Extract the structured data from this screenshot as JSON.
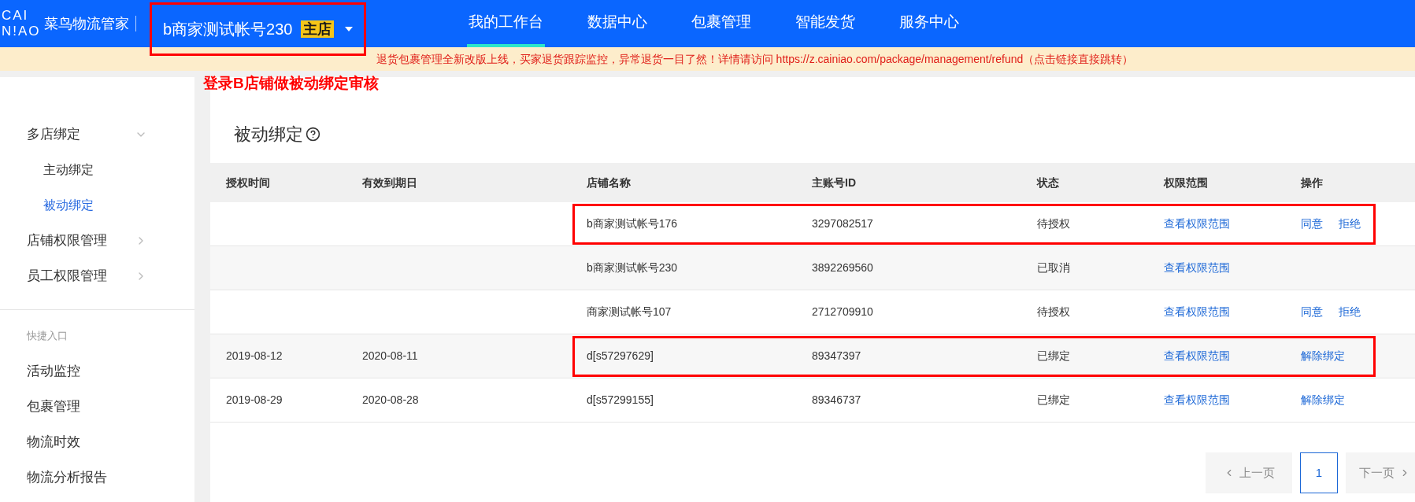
{
  "header": {
    "logo_mark": "CAI\nN!AO",
    "logo_text": "菜鸟物流管家",
    "account": "b商家测试帐号230",
    "account_badge": "主店",
    "nav": [
      {
        "label": "我的工作台",
        "selected": true
      },
      {
        "label": "数据中心",
        "selected": false
      },
      {
        "label": "包裹管理",
        "selected": false
      },
      {
        "label": "智能发货",
        "selected": false
      },
      {
        "label": "服务中心",
        "selected": false
      }
    ]
  },
  "notice": "退货包裹管理全新改版上线，买家退货跟踪监控，异常退货一目了然！详情请访问 https://z.cainiao.com/package/management/refund（点击链接直接跳转）",
  "annotation": "登录B店铺做被动绑定审核",
  "sidebar": {
    "groups": [
      {
        "label": "多店绑定",
        "expanded": true,
        "children": [
          {
            "label": "主动绑定",
            "selected": false
          },
          {
            "label": "被动绑定",
            "selected": true
          }
        ]
      },
      {
        "label": "店铺权限管理",
        "expanded": false
      },
      {
        "label": "员工权限管理",
        "expanded": false
      }
    ],
    "shortcut_title": "快捷入口",
    "shortcuts": [
      "活动监控",
      "包裹管理",
      "物流时效",
      "物流分析报告"
    ]
  },
  "page_title": "被动绑定",
  "table": {
    "columns": [
      "授权时间",
      "有效到期日",
      "店铺名称",
      "主账号ID",
      "状态",
      "权限范围",
      "操作"
    ],
    "rows": [
      {
        "auth_time": "",
        "expiry": "",
        "store": "b商家测试帐号176",
        "account_id": "3297082517",
        "status": "待授权",
        "scope": "查看权限范围",
        "actions": [
          "同意",
          "拒绝"
        ],
        "highlighted": true
      },
      {
        "auth_time": "",
        "expiry": "",
        "store": "b商家测试帐号230",
        "account_id": "3892269560",
        "status": "已取消",
        "scope": "查看权限范围",
        "actions": [],
        "highlighted": false
      },
      {
        "auth_time": "",
        "expiry": "",
        "store": "商家测试帐号107",
        "account_id": "2712709910",
        "status": "待授权",
        "scope": "查看权限范围",
        "actions": [
          "同意",
          "拒绝"
        ],
        "highlighted": false
      },
      {
        "auth_time": "2019-08-12",
        "expiry": "2020-08-11",
        "store": "d[s57297629]",
        "account_id": "89347397",
        "status": "已绑定",
        "scope": "查看权限范围",
        "actions": [
          "解除绑定"
        ],
        "highlighted": true
      },
      {
        "auth_time": "2019-08-29",
        "expiry": "2020-08-28",
        "store": "d[s57299155]",
        "account_id": "89346737",
        "status": "已绑定",
        "scope": "查看权限范围",
        "actions": [
          "解除绑定"
        ],
        "highlighted": false
      }
    ]
  },
  "pagination": {
    "prev": "上一页",
    "pages": [
      {
        "label": "1",
        "selected": true
      }
    ],
    "next": "下一页",
    "prev_disabled": true,
    "next_disabled": true
  }
}
